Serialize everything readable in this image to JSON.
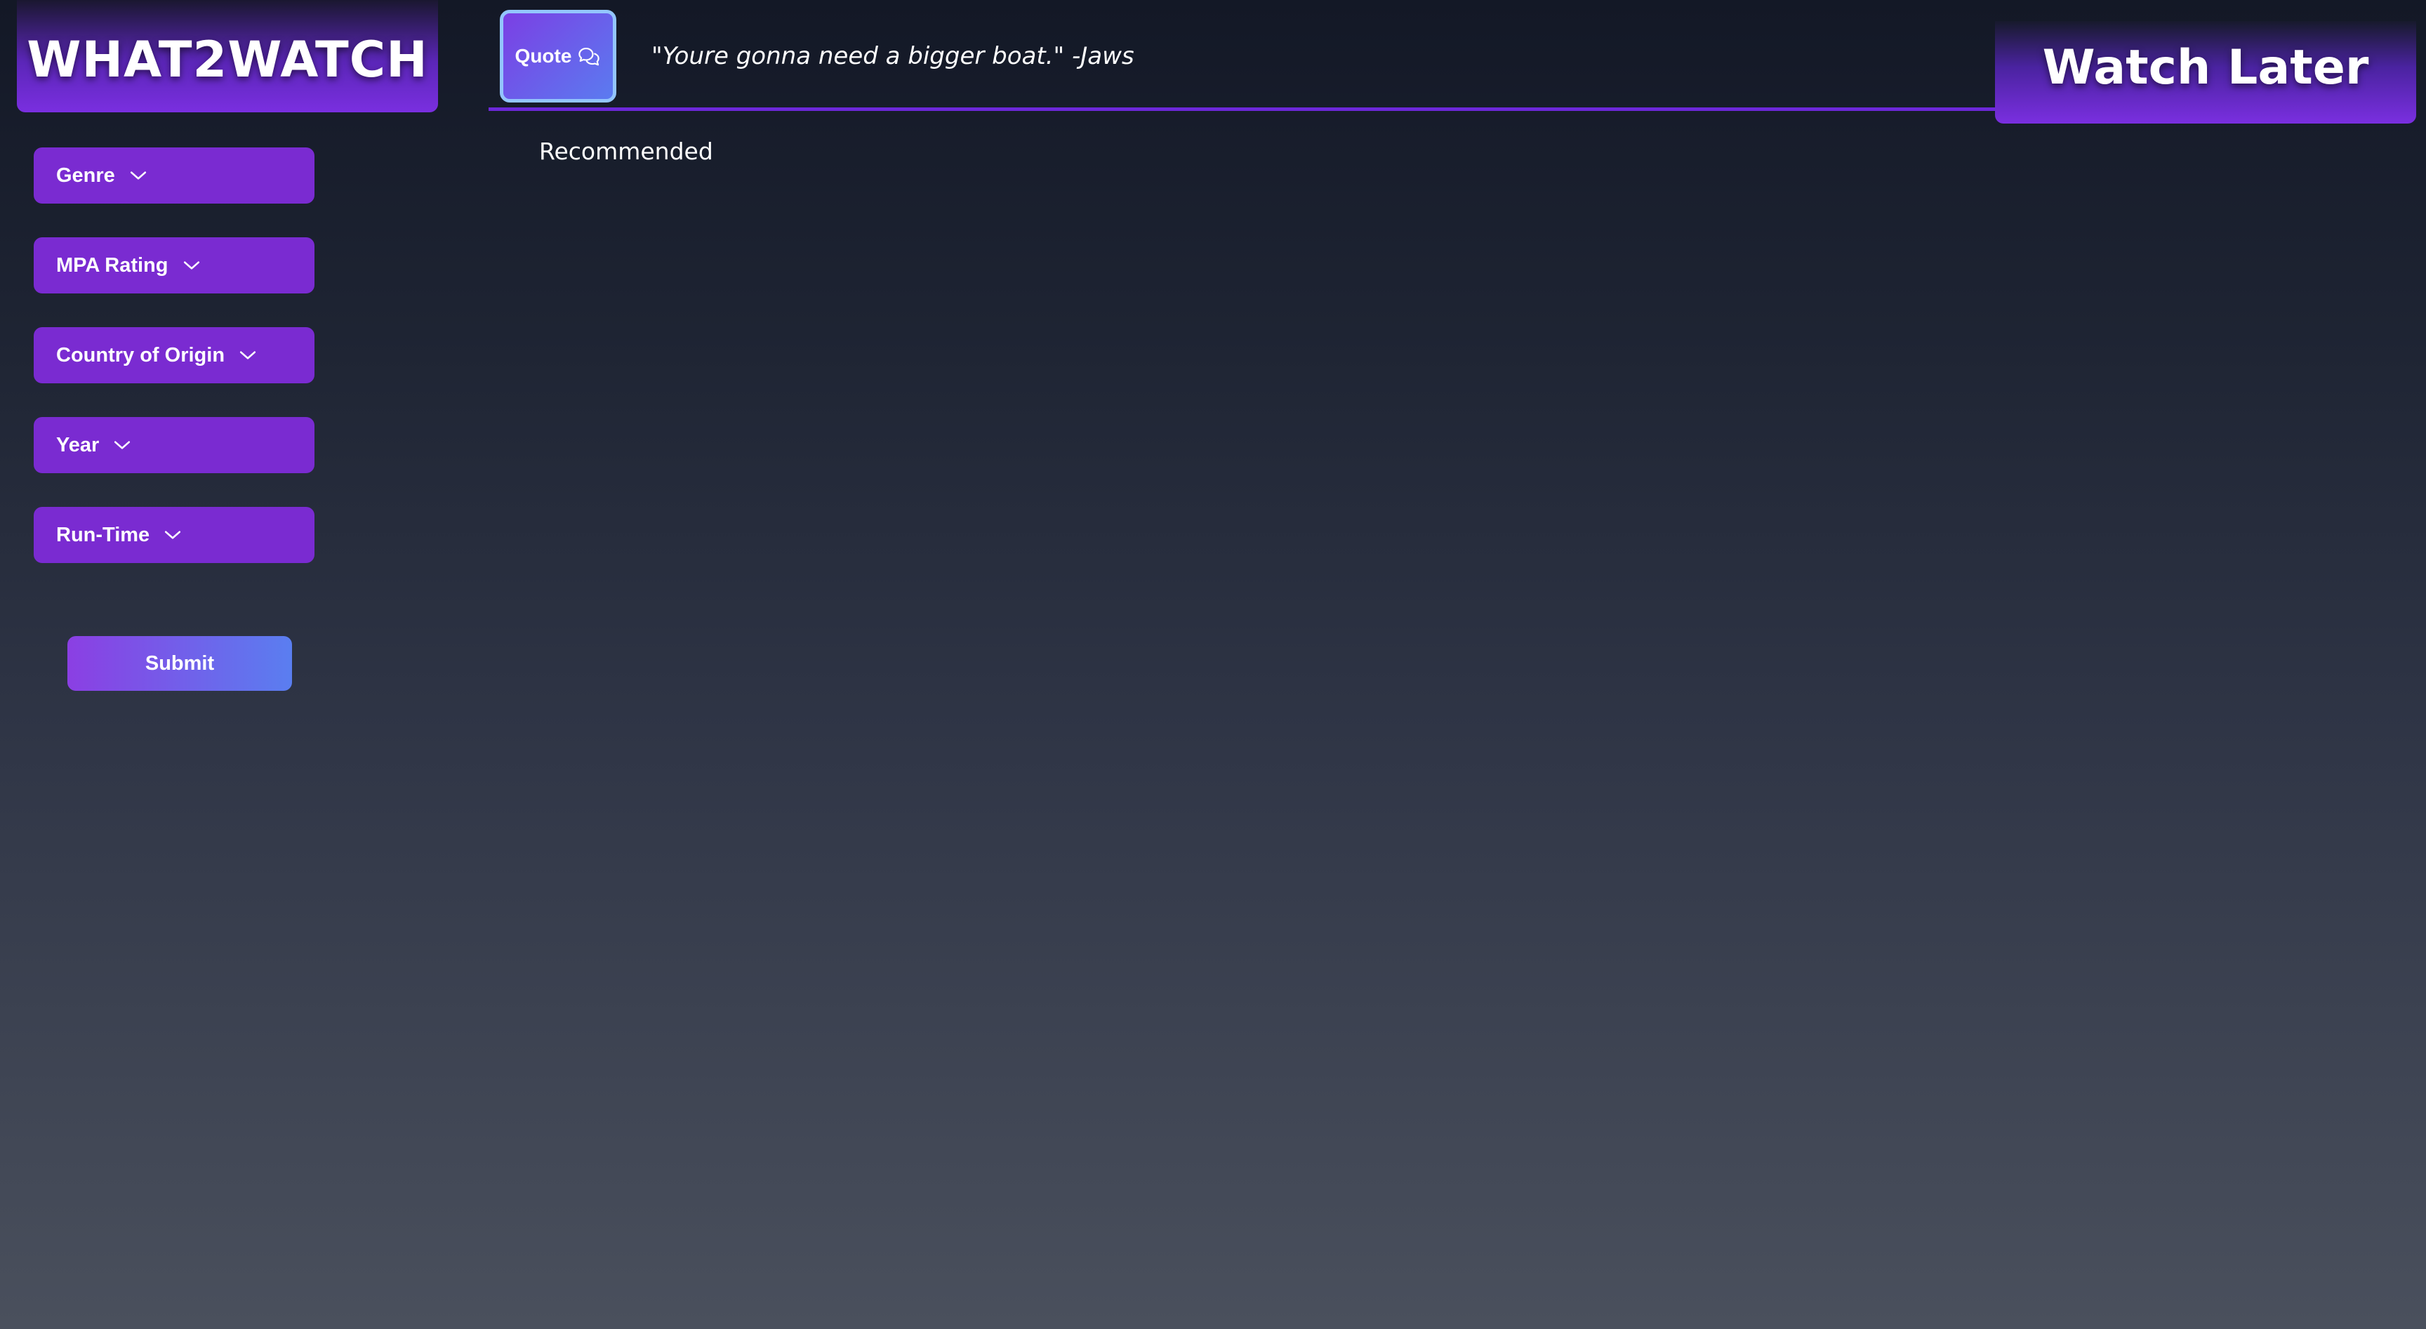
{
  "app": {
    "logo_text": "WHAT2WATCH",
    "watch_later_label": "Watch Later"
  },
  "header": {
    "quote_button_label": "Quote",
    "quote_text": "\"Youre gonna need a bigger boat.\" -Jaws"
  },
  "main": {
    "section_label": "Recommended"
  },
  "sidebar": {
    "filters": [
      {
        "label": "Genre",
        "icon": "chevron-down-icon"
      },
      {
        "label": "MPA Rating",
        "icon": "chevron-down-icon"
      },
      {
        "label": "Country of Origin",
        "icon": "chevron-down-icon"
      },
      {
        "label": "Year",
        "icon": "chevron-down-icon"
      },
      {
        "label": "Run-Time",
        "icon": "chevron-down-icon"
      }
    ],
    "submit_label": "Submit"
  },
  "colors": {
    "accent_purple": "#7a2bd1",
    "accent_blue": "#5a7ef0",
    "quote_border": "#93c5fd"
  },
  "icons": {
    "quote_button": "chat-bubbles-icon"
  }
}
